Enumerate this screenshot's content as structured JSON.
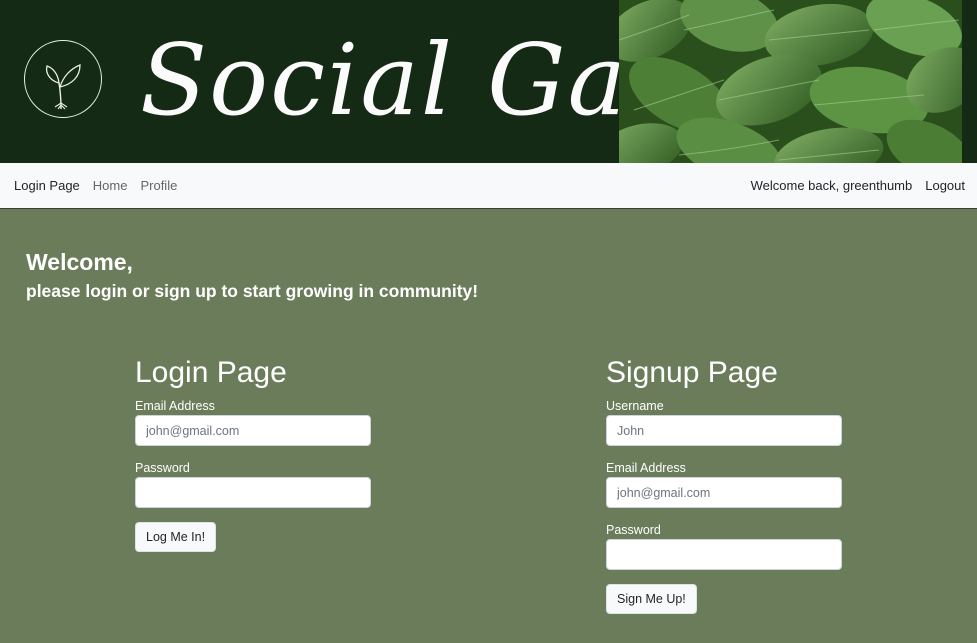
{
  "header": {
    "title": "Social Garden",
    "logo_icon": "sprout-icon",
    "banner_image": "hosta-leaves-photo",
    "colors": {
      "background": "#142a14",
      "leaf": "#3d6b2c"
    }
  },
  "nav": {
    "brand": "Login Page",
    "links": [
      {
        "label": "Home"
      },
      {
        "label": "Profile"
      }
    ],
    "welcome_text": "Welcome back, greenthumb",
    "logout": "Logout"
  },
  "welcome": {
    "heading": "Welcome,",
    "subheading": "please login or sign up to start growing in community!"
  },
  "login": {
    "title": "Login Page",
    "email_label": "Email Address",
    "email_placeholder": "john@gmail.com",
    "email_value": "",
    "password_label": "Password",
    "password_value": "",
    "submit": "Log Me In!"
  },
  "signup": {
    "title": "Signup Page",
    "username_label": "Username",
    "username_placeholder": "John",
    "username_value": "",
    "email_label": "Email Address",
    "email_placeholder": "john@gmail.com",
    "email_value": "",
    "password_label": "Password",
    "password_value": "",
    "submit": "Sign Me Up!"
  },
  "theme": {
    "page_background": "#6b7c5b",
    "navbar_background": "#f8f9fa"
  }
}
